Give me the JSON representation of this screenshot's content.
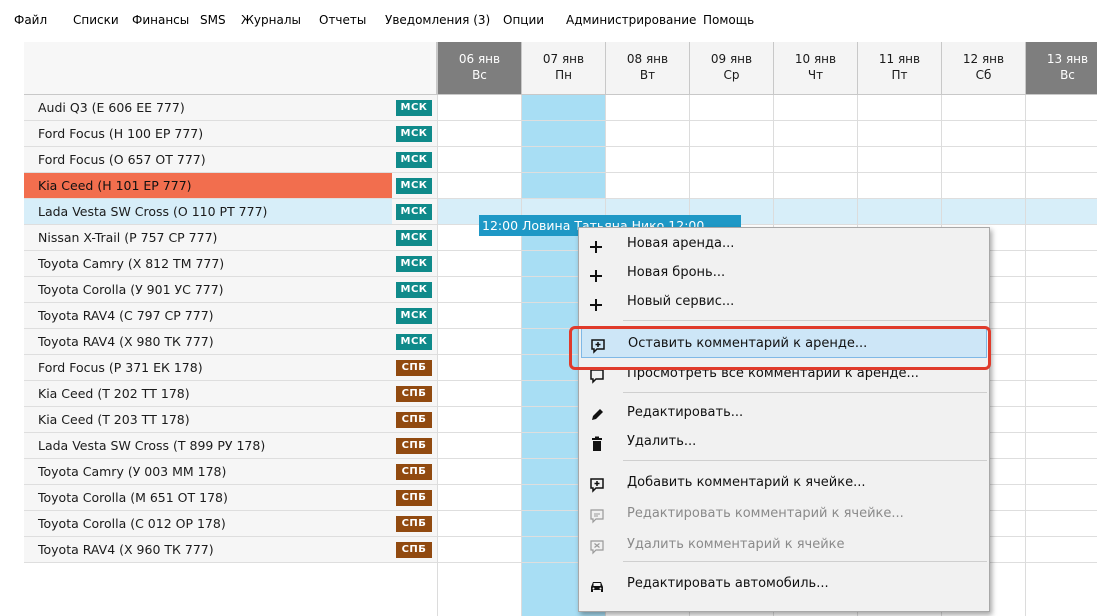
{
  "menu": [
    "Файл",
    "Списки",
    "Финансы",
    "SMS",
    "Журналы",
    "Отчеты",
    "Уведомления (3)",
    "Опции",
    "Администрирование",
    "Помощь"
  ],
  "days": [
    {
      "date": "06 янв",
      "weekday": "Вс",
      "weekend": true
    },
    {
      "date": "07 янв",
      "weekday": "Пн",
      "weekend": false
    },
    {
      "date": "08 янв",
      "weekday": "Вт",
      "weekend": false
    },
    {
      "date": "09 янв",
      "weekday": "Ср",
      "weekend": false
    },
    {
      "date": "10 янв",
      "weekday": "Чт",
      "weekend": false
    },
    {
      "date": "11 янв",
      "weekday": "Пт",
      "weekend": false
    },
    {
      "date": "12 янв",
      "weekday": "Сб",
      "weekend": false
    },
    {
      "date": "13 янв",
      "weekday": "Вс",
      "weekend": true
    }
  ],
  "vehicles": [
    {
      "name": "Audi Q3 (Е 606 ЕЕ 777)",
      "city": "МСК",
      "city_type": "msk",
      "state": ""
    },
    {
      "name": "Ford Focus (Н 100 ЕР 777)",
      "city": "МСК",
      "city_type": "msk",
      "state": ""
    },
    {
      "name": "Ford Focus (О 657 ОТ 777)",
      "city": "МСК",
      "city_type": "msk",
      "state": ""
    },
    {
      "name": "Kia Ceed (Н 101 ЕР 777)",
      "city": "МСК",
      "city_type": "msk",
      "state": "alert"
    },
    {
      "name": "Lada Vesta SW Cross (О 110 РТ 777)",
      "city": "МСК",
      "city_type": "msk",
      "state": "current"
    },
    {
      "name": "Nissan X-Trail (Р 757 СР 777)",
      "city": "МСК",
      "city_type": "msk",
      "state": ""
    },
    {
      "name": "Toyota Camry (Х 812 ТМ 777)",
      "city": "МСК",
      "city_type": "msk",
      "state": ""
    },
    {
      "name": "Toyota Corolla (У 901 УС 777)",
      "city": "МСК",
      "city_type": "msk",
      "state": ""
    },
    {
      "name": "Toyota RAV4 (С 797 СР 777)",
      "city": "МСК",
      "city_type": "msk",
      "state": ""
    },
    {
      "name": "Toyota RAV4 (Х 980 ТК 777)",
      "city": "МСК",
      "city_type": "msk",
      "state": ""
    },
    {
      "name": "Ford Focus (Р 371 ЕК 178)",
      "city": "СПБ",
      "city_type": "spb",
      "state": ""
    },
    {
      "name": "Kia Ceed (Т 202 ТТ 178)",
      "city": "СПБ",
      "city_type": "spb",
      "state": ""
    },
    {
      "name": "Kia Ceed (Т 203 ТТ 178)",
      "city": "СПБ",
      "city_type": "spb",
      "state": ""
    },
    {
      "name": "Lada Vesta SW Cross (Т 899 РУ 178)",
      "city": "СПБ",
      "city_type": "spb",
      "state": ""
    },
    {
      "name": "Toyota Camry (У 003 ММ 178)",
      "city": "СПБ",
      "city_type": "spb",
      "state": ""
    },
    {
      "name": "Toyota Corolla (М 651 ОТ 178)",
      "city": "СПБ",
      "city_type": "spb",
      "state": ""
    },
    {
      "name": "Toyota Corolla (С 012 ОР 178)",
      "city": "СПБ",
      "city_type": "spb",
      "state": ""
    },
    {
      "name": "Toyota RAV4 (Х 960 ТК 777)",
      "city": "СПБ",
      "city_type": "spb",
      "state": ""
    }
  ],
  "current_row_marker": "▶",
  "rental": {
    "text": "12:00 Ловина Татьяна Нико 12:00"
  },
  "context_menu": {
    "items": [
      {
        "label": "Новая аренда...",
        "icon": "plus-icon",
        "disabled": false
      },
      {
        "label": "Новая бронь...",
        "icon": "plus-icon",
        "disabled": false
      },
      {
        "label": "Новый сервис...",
        "icon": "plus-icon",
        "disabled": false
      },
      {
        "label": "Оставить комментарий к аренде...",
        "icon": "comment-add-icon",
        "disabled": false
      },
      {
        "label": "Просмотреть все комментарии к аренде...",
        "icon": "comment-icon",
        "disabled": false
      },
      {
        "label": "Редактировать...",
        "icon": "pencil-icon",
        "disabled": false
      },
      {
        "label": "Удалить...",
        "icon": "trash-icon",
        "disabled": false
      },
      {
        "label": "Добавить комментарий к ячейке...",
        "icon": "comment-add-icon",
        "disabled": false
      },
      {
        "label": "Редактировать комментарий к ячейке...",
        "icon": "comment-edit-icon",
        "disabled": true
      },
      {
        "label": "Удалить комментарий к ячейке",
        "icon": "comment-delete-icon",
        "disabled": true
      },
      {
        "label": "Редактировать автомобиль...",
        "icon": "car-icon",
        "disabled": false
      }
    ],
    "highlighted_index": 3
  },
  "colors": {
    "msk_badge": "#0f8a8a",
    "spb_badge": "#914a10",
    "alert_row": "#f26e4e",
    "today_column": "#a8def4",
    "rental_bar": "#1e98c6",
    "highlight_frame": "#e03b2b"
  }
}
